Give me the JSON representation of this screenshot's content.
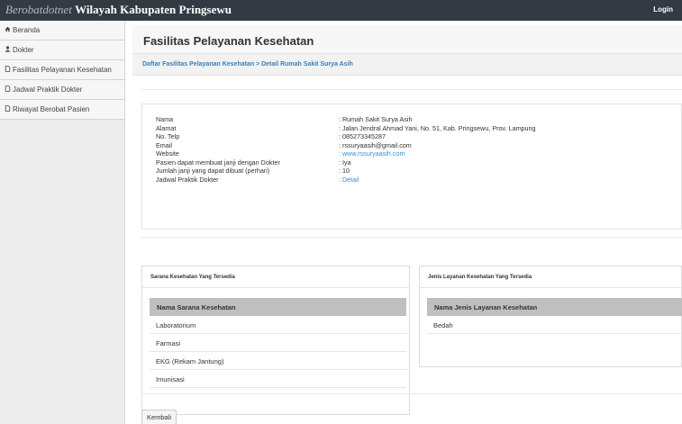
{
  "header": {
    "brand_prefix": "Berobatdotnet",
    "brand_suffix": "Wilayah Kabupaten Pringsewu",
    "login_label": "Login"
  },
  "sidebar": {
    "items": [
      {
        "label": "Beranda",
        "icon": "home-icon"
      },
      {
        "label": "Dokter",
        "icon": "user-icon"
      },
      {
        "label": "Fasilitas Pelayanan Kesehatan",
        "icon": "document-icon"
      },
      {
        "label": "Jadwal Praktik Dokter",
        "icon": "document-icon"
      },
      {
        "label": "Riwayat Berobat Pasien",
        "icon": "document-icon"
      }
    ]
  },
  "page": {
    "title": "Fasilitas Pelayanan Kesehatan",
    "breadcrumb": "Daftar Fasilitas Pelayanan Kesehatan > Detail Rumah Sakit Surya Asih"
  },
  "detail": {
    "rows": [
      {
        "label": "Nama",
        "value": ": Rumah Sakit Surya Asih"
      },
      {
        "label": "Alamat",
        "value": ": Jalan Jendral Ahmad Yani, No. 51, Kab. Pringsewu, Prov. Lampung"
      },
      {
        "label": "No. Telp",
        "value": ": 085273345287"
      },
      {
        "label": "Email",
        "value": ": rssuryaasih@gmail.com"
      },
      {
        "label": "Website",
        "value": ": www.rssuryaasih.com"
      },
      {
        "label": "Pasien dapat membuat janji dengan Dokter",
        "value": ": Iya"
      },
      {
        "label": "Jumlah janji yang dapat dibuat (perhari)",
        "value": ": 10"
      },
      {
        "label": "Jadwal Praktik Dokter",
        "value": ": Detail"
      }
    ]
  },
  "sarana": {
    "title": "Sarana Kesehatan Yang Tersedia",
    "header": "Nama Sarana Kesehatan",
    "rows": [
      "Laboratorium",
      "Farmasi",
      "EKG (Rekam Jantung)",
      "Imunisasi"
    ]
  },
  "layanan": {
    "title": "Jenis Layanan Kesehatan Yang Tersedia",
    "header": "Nama Jenis Layanan Kesehatan",
    "rows": [
      "Bedah"
    ]
  },
  "actions": {
    "back_label": "Kembali"
  },
  "colors": {
    "navbar": "#333a44",
    "link": "#3a8fcf",
    "breadcrumb": "#3a7fb7",
    "table_header": "#bfbfbf"
  }
}
